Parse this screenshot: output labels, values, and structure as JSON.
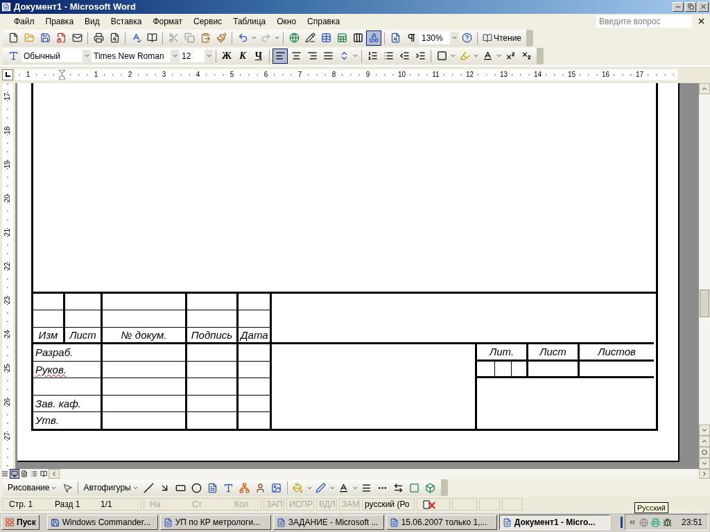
{
  "window": {
    "title": "Документ1 - Microsoft Word"
  },
  "menu": [
    "Файл",
    "Правка",
    "Вид",
    "Вставка",
    "Формат",
    "Сервис",
    "Таблица",
    "Окно",
    "Справка"
  ],
  "help_search": {
    "placeholder": "Введите вопрос"
  },
  "standard_toolbar": {
    "drawing_on": true,
    "zoom": "130%",
    "reading_button": "Чтение"
  },
  "formatting_toolbar": {
    "style": "Обычный",
    "font": "Times New Roman",
    "size": "12",
    "bold": "Ж",
    "italic": "К",
    "underline": "Ч",
    "alignment": [
      {
        "selected": true
      },
      {
        "selected": false
      },
      {
        "selected": false
      },
      {
        "selected": false
      }
    ]
  },
  "horizontal_ruler": [
    "1",
    "1",
    "2",
    "3",
    "4",
    "5",
    "6",
    "7",
    "8",
    "9",
    "10",
    "11",
    "12",
    "13",
    "14",
    "15",
    "16",
    "17"
  ],
  "vertical_ruler": [
    "17",
    "18",
    "19",
    "20",
    "21",
    "22",
    "23",
    "24",
    "25",
    "26",
    "27"
  ],
  "title_block": {
    "header": [
      "Изм",
      "Лист",
      "№ докум.",
      "Подпись",
      "Дата"
    ],
    "signature_rows": [
      {
        "label": "Разраб.",
        "spelling_error": false
      },
      {
        "label": "Руков.",
        "spelling_error": true
      },
      {},
      {
        "label": "Зав. каф.",
        "spelling_error": false
      },
      {
        "label": "Утв.",
        "spelling_error": false
      }
    ],
    "sheet_header": [
      "Лит.",
      "Лист",
      "Листов"
    ]
  },
  "drawing_toolbar": {
    "drawing_menu": "Рисование",
    "autoshapes": "Автофигуры"
  },
  "status_bar": {
    "position": [
      "Стр. 1",
      "Разд 1",
      "1/1"
    ],
    "cursor": [
      {
        "text": "На",
        "disabled": true
      },
      {
        "text": "Ст",
        "disabled": true
      },
      {
        "text": "Кол",
        "disabled": true
      }
    ],
    "modes": [
      {
        "text": "ЗАП",
        "disabled": true
      },
      {
        "text": "ИСПР",
        "disabled": true
      },
      {
        "text": "ВДЛ",
        "disabled": true
      },
      {
        "text": "ЗАМ",
        "disabled": true
      }
    ],
    "language": "русский (Ро"
  },
  "taskbar": {
    "start": "Пуск",
    "tasks": [
      {
        "label": "Windows Commander...",
        "selected": false
      },
      {
        "label": "УП по КР метрологи...",
        "selected": false
      },
      {
        "label": "ЗАДАНИЕ - Microsoft ...",
        "selected": false
      },
      {
        "label": "15.06.2007 только 1,...",
        "selected": false
      },
      {
        "label": "Документ1 - Micro...",
        "selected": true
      }
    ],
    "clock": "23:51",
    "tooltip": "Русский"
  }
}
